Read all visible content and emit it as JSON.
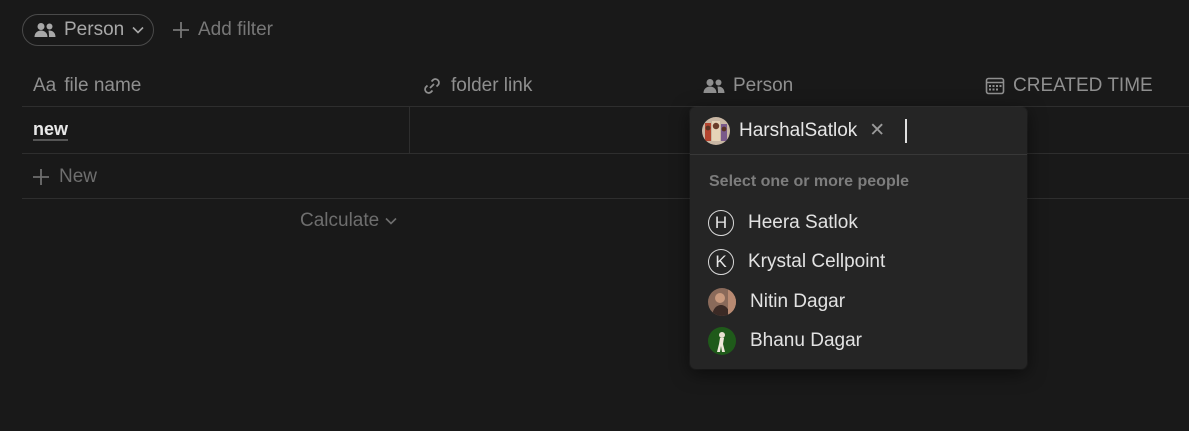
{
  "filter_bar": {
    "person_chip": {
      "label": "Person",
      "icon": "people-icon"
    },
    "add_filter_label": "Add filter"
  },
  "table": {
    "columns": [
      {
        "label": "file name",
        "icon": "text-aa-icon",
        "icon_text": "Aa"
      },
      {
        "label": "folder link",
        "icon": "link-icon"
      },
      {
        "label": "Person",
        "icon": "people-icon"
      },
      {
        "label": "CREATED TIME",
        "icon": "calendar-icon"
      }
    ],
    "rows": [
      {
        "file_name": "new"
      }
    ],
    "new_row_label": "New",
    "calculate_label": "Calculate"
  },
  "person_dropdown": {
    "selected": [
      {
        "name": "HarshalSatlok"
      }
    ],
    "hint": "Select one or more people",
    "options": [
      {
        "name": "Heera Satlok",
        "initial": "H"
      },
      {
        "name": "Krystal Cellpoint",
        "initial": "K"
      },
      {
        "name": "Nitin Dagar",
        "initial": ""
      },
      {
        "name": "Bhanu Dagar",
        "initial": ""
      }
    ]
  },
  "colors": {
    "background": "#191919",
    "dropdown_bg": "#252525",
    "border": "#2e2e2e",
    "text_primary": "#e2e2e2",
    "text_muted": "#8f8f8f"
  }
}
